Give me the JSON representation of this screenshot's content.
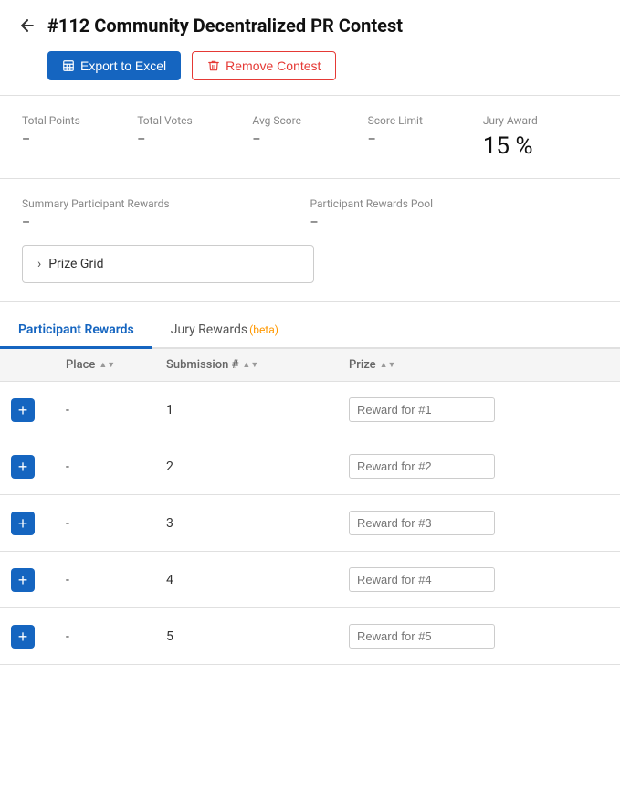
{
  "page": {
    "title": "#112 Community Decentralized PR Contest",
    "back_label": "←"
  },
  "toolbar": {
    "export_label": "Export to Excel",
    "remove_label": "Remove Contest"
  },
  "stats": {
    "items": [
      {
        "label": "Total Points",
        "value": "–"
      },
      {
        "label": "Total Votes",
        "value": "–"
      },
      {
        "label": "Avg Score",
        "value": "–"
      },
      {
        "label": "Score Limit",
        "value": "–"
      },
      {
        "label": "Jury Award",
        "value": "15 %"
      }
    ]
  },
  "summary": {
    "participant_rewards_label": "Summary Participant Rewards",
    "participant_rewards_value": "–",
    "rewards_pool_label": "Participant Rewards Pool",
    "rewards_pool_value": "–",
    "prize_grid_label": "Prize Grid"
  },
  "tabs": [
    {
      "id": "participant",
      "label": "Participant Rewards",
      "active": true,
      "beta": false
    },
    {
      "id": "jury",
      "label": "Jury Rewards",
      "active": false,
      "beta": true,
      "beta_label": "(beta)"
    }
  ],
  "table": {
    "headers": [
      {
        "id": "action",
        "label": ""
      },
      {
        "id": "place",
        "label": "Place"
      },
      {
        "id": "submission",
        "label": "Submission #"
      },
      {
        "id": "prize",
        "label": "Prize"
      }
    ],
    "rows": [
      {
        "place": "-",
        "submission": "1",
        "prize_placeholder": "Reward for #1"
      },
      {
        "place": "-",
        "submission": "2",
        "prize_placeholder": "Reward for #2"
      },
      {
        "place": "-",
        "submission": "3",
        "prize_placeholder": "Reward for #3"
      },
      {
        "place": "-",
        "submission": "4",
        "prize_placeholder": "Reward for #4"
      },
      {
        "place": "-",
        "submission": "5",
        "prize_placeholder": "Reward for #5"
      }
    ]
  }
}
